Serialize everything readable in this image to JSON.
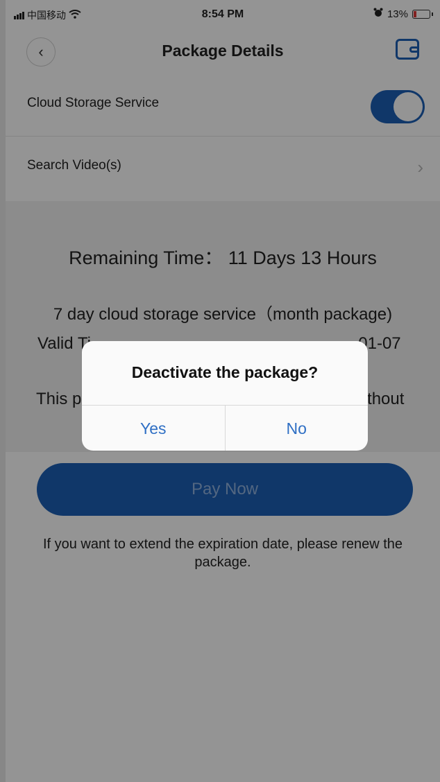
{
  "status_bar": {
    "carrier": "中国移动",
    "time": "8:54 PM",
    "battery": "13%"
  },
  "header": {
    "title": "Package Details"
  },
  "settings": {
    "cloud_storage_label": "Cloud Storage Service",
    "cloud_storage_on": true,
    "search_video_label": "Search Video(s)"
  },
  "package": {
    "remaining_time": "Remaining Time： 11 Days 13 Hours",
    "name": "7 day cloud storage service（month package)",
    "valid_time_left": "Valid Ti",
    "valid_time_right": "01-07",
    "note_left": "This p",
    "note_right": "ithout"
  },
  "pay_button": "Pay Now",
  "hint": "If you want to extend the expiration date, please renew the package.",
  "dialog": {
    "title": "Deactivate the package?",
    "yes": "Yes",
    "no": "No"
  },
  "colors": {
    "accent": "#1d5fb5",
    "dialog_link": "#2f6fc4",
    "battery_low": "#e03a3a"
  }
}
